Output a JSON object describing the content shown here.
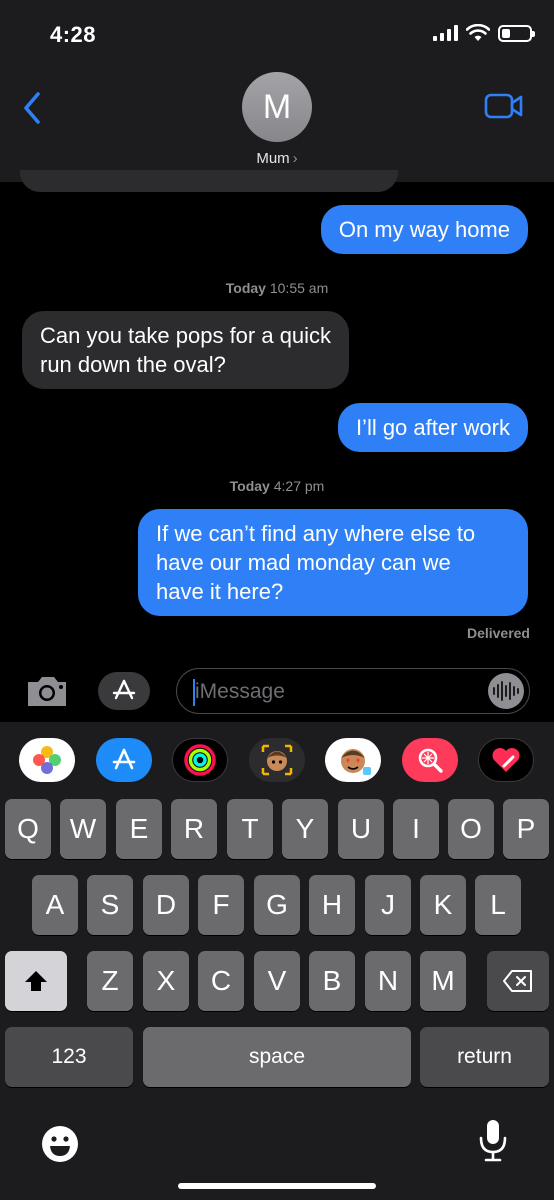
{
  "status_bar": {
    "time": "4:28",
    "battery_level": 0.3
  },
  "header": {
    "avatar_initial": "M",
    "contact_name": "Mum",
    "chevron": "›",
    "back_icon": "chevron-left-icon",
    "video_icon": "video-camera-icon"
  },
  "messages": [
    {
      "type": "out",
      "text": "On my way home"
    },
    {
      "type": "timestamp",
      "day": "Today",
      "time": "10:55 am"
    },
    {
      "type": "in",
      "lines": [
        "Can you take pops for a quick",
        "run down the oval?"
      ]
    },
    {
      "type": "out",
      "text": "I’ll go after work"
    },
    {
      "type": "timestamp",
      "day": "Today",
      "time": "4:27 pm"
    },
    {
      "type": "out",
      "lines": [
        "If we can’t find any where else to",
        "have our mad monday can we",
        "have it here?"
      ]
    }
  ],
  "delivered_label": "Delivered",
  "input": {
    "placeholder": "iMessage"
  },
  "app_strip": [
    "photos-icon",
    "app-store-icon",
    "activity-icon",
    "memoji-icon",
    "memoji-stickers-icon",
    "images-search-icon",
    "digital-touch-icon"
  ],
  "keyboard": {
    "row1": [
      "Q",
      "W",
      "E",
      "R",
      "T",
      "Y",
      "U",
      "I",
      "O",
      "P"
    ],
    "row2": [
      "A",
      "S",
      "D",
      "F",
      "G",
      "H",
      "J",
      "K",
      "L"
    ],
    "row3": [
      "Z",
      "X",
      "C",
      "V",
      "B",
      "N",
      "M"
    ],
    "numbers_label": "123",
    "space_label": "space",
    "return_label": "return"
  },
  "colors": {
    "sent_bubble": "#2f80f7",
    "received_bubble": "#2c2c2e",
    "accent": "#2f80f7"
  }
}
